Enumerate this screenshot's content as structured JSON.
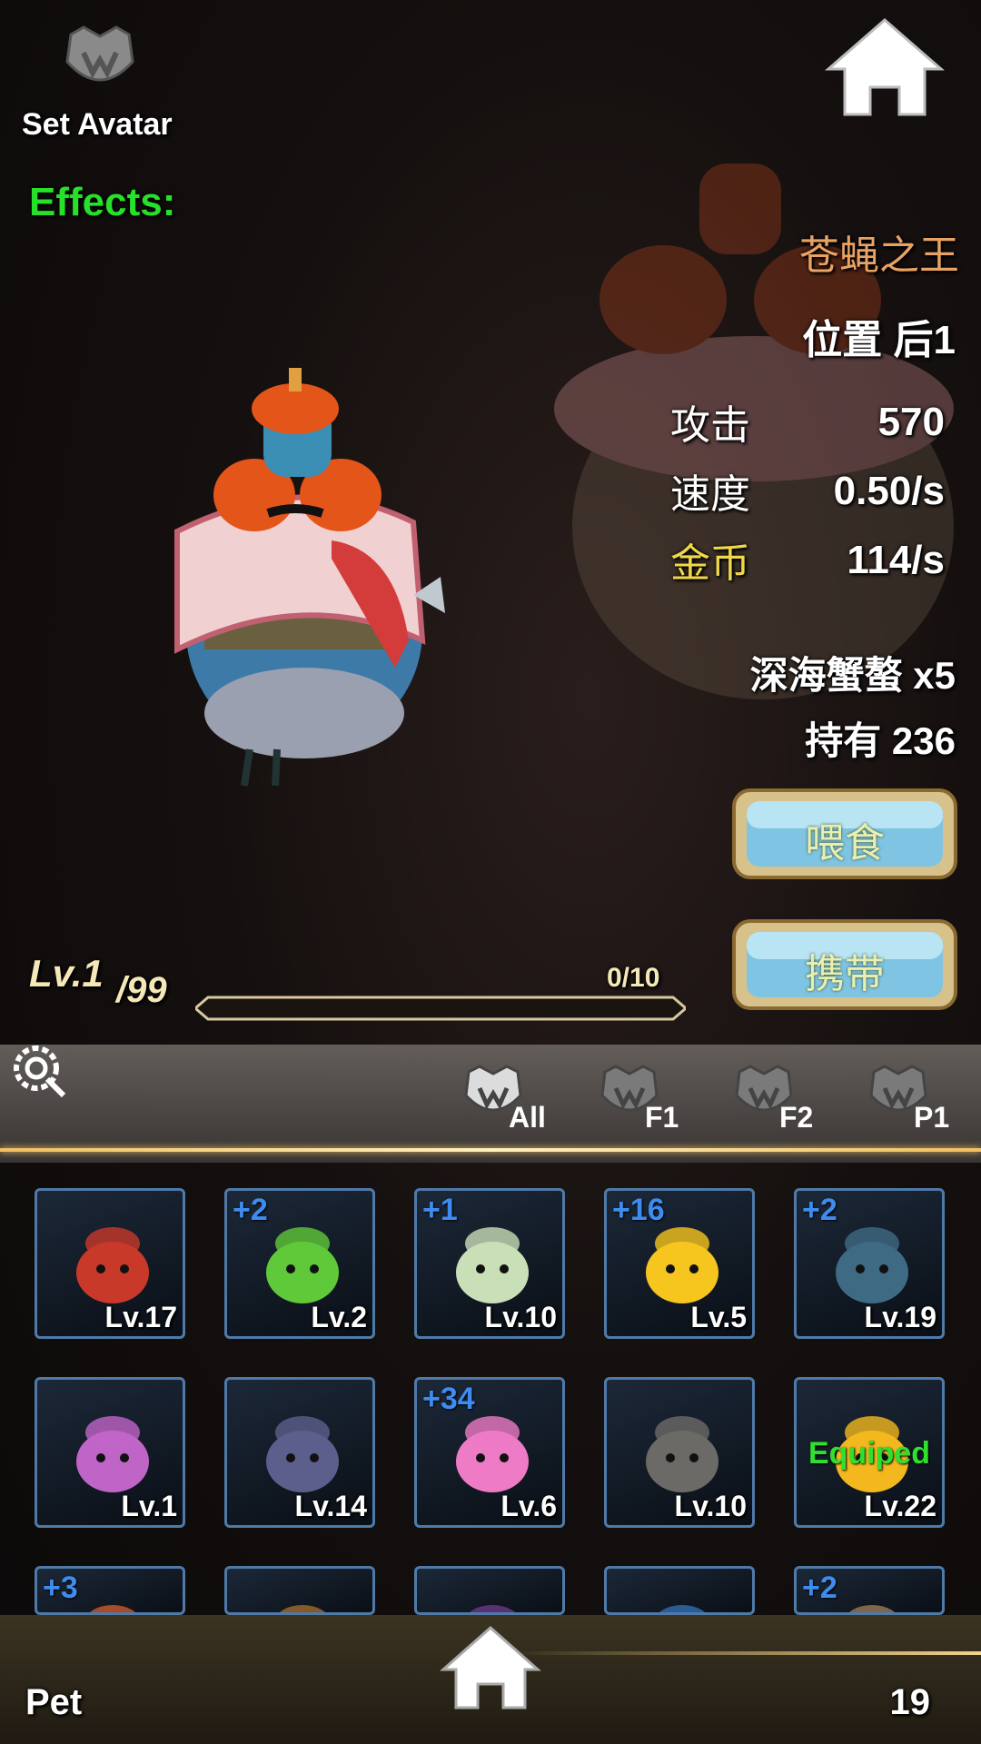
{
  "top": {
    "set_avatar_label": "Set Avatar",
    "effects_label": "Effects:"
  },
  "pet": {
    "name": "苍蝇之王",
    "position": "位置 后1",
    "stats": [
      {
        "label": "攻击",
        "value": "570",
        "label_color": "#ffffff"
      },
      {
        "label": "速度",
        "value": "0.50/s",
        "label_color": "#ffffff"
      },
      {
        "label": "金币",
        "value": "114/s",
        "label_color": "#f0d84a"
      }
    ],
    "feed_material": "深海蟹螯 x5",
    "owned": "持有 236",
    "feed_button": "喂食",
    "carry_button": "携带",
    "level": "Lv.1",
    "level_max": "/99",
    "exp": "0/10",
    "exp_fraction": 0
  },
  "filters": [
    {
      "label": "All"
    },
    {
      "label": "F1"
    },
    {
      "label": "F2"
    },
    {
      "label": "P1"
    }
  ],
  "cards": [
    {
      "plus": "",
      "level": "Lv.17",
      "equipped": "",
      "icon": "mushroom-red-icon",
      "color": "#c8392a"
    },
    {
      "plus": "+2",
      "level": "Lv.2",
      "equipped": "",
      "icon": "green-slime-icon",
      "color": "#5fc93a"
    },
    {
      "plus": "+1",
      "level": "Lv.10",
      "equipped": "",
      "icon": "rabbit-icon",
      "color": "#c9dfb8"
    },
    {
      "plus": "+16",
      "level": "Lv.5",
      "equipped": "",
      "icon": "chick-icon",
      "color": "#f6c51e"
    },
    {
      "plus": "+2",
      "level": "Lv.19",
      "equipped": "",
      "icon": "crab-icon",
      "color": "#3f6a84"
    },
    {
      "plus": "",
      "level": "Lv.1",
      "equipped": "",
      "icon": "mushroom-purple-icon",
      "color": "#c065c8"
    },
    {
      "plus": "",
      "level": "Lv.14",
      "equipped": "",
      "icon": "fly-icon",
      "color": "#5c5f8c"
    },
    {
      "plus": "+34",
      "level": "Lv.6",
      "equipped": "",
      "icon": "pink-slime-icon",
      "color": "#ee7bc6"
    },
    {
      "plus": "",
      "level": "Lv.10",
      "equipped": "",
      "icon": "robot-icon",
      "color": "#6c6a66"
    },
    {
      "plus": "",
      "level": "Lv.22",
      "equipped": "Equiped",
      "icon": "miner-icon",
      "color": "#f2b81e"
    },
    {
      "plus": "+3",
      "level": "",
      "equipped": "",
      "icon": "orange-creature-icon",
      "color": "#d0582a"
    },
    {
      "plus": "",
      "level": "",
      "equipped": "",
      "icon": "brown-creature-icon",
      "color": "#a26a2a"
    },
    {
      "plus": "",
      "level": "",
      "equipped": "",
      "icon": "purple-creature-icon",
      "color": "#6a3a8a"
    },
    {
      "plus": "",
      "level": "",
      "equipped": "",
      "icon": "blue-creature-icon",
      "color": "#2f6fb0"
    },
    {
      "plus": "+2",
      "level": "",
      "equipped": "",
      "icon": "tan-creature-icon",
      "color": "#9a7a58"
    }
  ],
  "bottom": {
    "pet_label": "Pet",
    "pet_count": "19"
  }
}
